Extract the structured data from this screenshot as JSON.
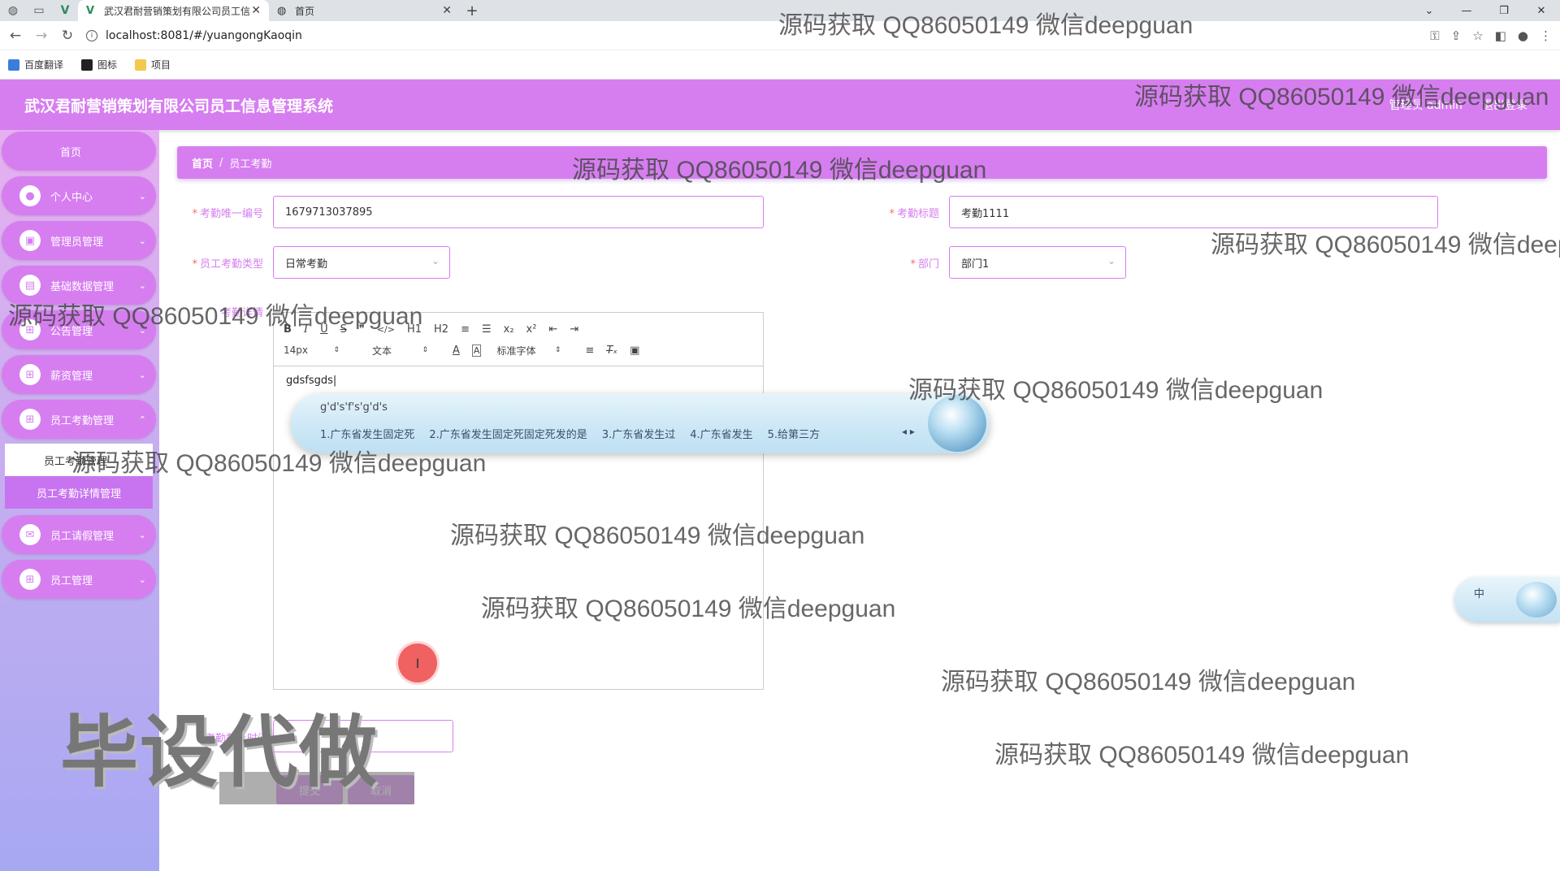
{
  "browser": {
    "tabs": [
      {
        "title": "武汉君耐营销策划有限公司员工信",
        "active": true
      },
      {
        "title": "首页",
        "active": false
      }
    ],
    "url": "localhost:8081/#/yuangongKaoqin",
    "bookmarks": [
      "百度翻译",
      "图标",
      "项目"
    ]
  },
  "header": {
    "title": "武汉君耐营销策划有限公司员工信息管理系统",
    "user": "管理员 admin",
    "logout": "退出登录"
  },
  "sidebar": {
    "home": "首页",
    "items": [
      {
        "label": "个人中心",
        "icon": "person-icon"
      },
      {
        "label": "管理员管理",
        "icon": "admin-icon"
      },
      {
        "label": "基础数据管理",
        "icon": "data-icon"
      },
      {
        "label": "公告管理",
        "icon": "grid-icon"
      },
      {
        "label": "薪资管理",
        "icon": "grid-icon"
      },
      {
        "label": "员工考勤管理",
        "icon": "grid-icon"
      }
    ],
    "subitems": [
      "员工考勤管理",
      "员工考勤详情管理"
    ],
    "items_after": [
      {
        "label": "员工请假管理",
        "icon": "chat-icon"
      },
      {
        "label": "员工管理",
        "icon": "grid-icon"
      }
    ]
  },
  "breadcrumb": {
    "home": "首页",
    "sep": "/",
    "current": "员工考勤"
  },
  "form": {
    "kaoqin_id_label": "考勤唯一编号",
    "kaoqin_id_value": "1679713037895",
    "kaoqin_title_label": "考勤标题",
    "kaoqin_title_value": "考勤1111",
    "type_label": "员工考勤类型",
    "type_value": "日常考勤",
    "dept_label": "部门",
    "dept_value": "部门1",
    "editor_label": "考勤详情",
    "editor_content": "gdsfsgds",
    "lower_label": "考勤截止时间",
    "submit": "提交",
    "cancel": "取消"
  },
  "toolbar": {
    "row1": [
      "B",
      "I",
      "U",
      "S",
      "❞",
      "</>",
      "H1",
      "H2",
      "≡",
      "☰",
      "x₂",
      "x²",
      "⇤",
      "⇥"
    ],
    "font_size": "14px",
    "header_picker": "文本",
    "font_family": "标准字体"
  },
  "ime": {
    "composition": "g'd's'f's'g'd's",
    "candidates": [
      "1.广东省发生固定死",
      "2.广东省发生固定死固定死发的是",
      "3.广东省发生过",
      "4.广东省发生",
      "5.给第三方"
    ],
    "status": "中"
  },
  "watermark": "源码获取 QQ86050149 微信deepguan",
  "stamp": "毕设代做",
  "colors": {
    "accent": "#d67ef0",
    "required": "#f56c6c"
  }
}
